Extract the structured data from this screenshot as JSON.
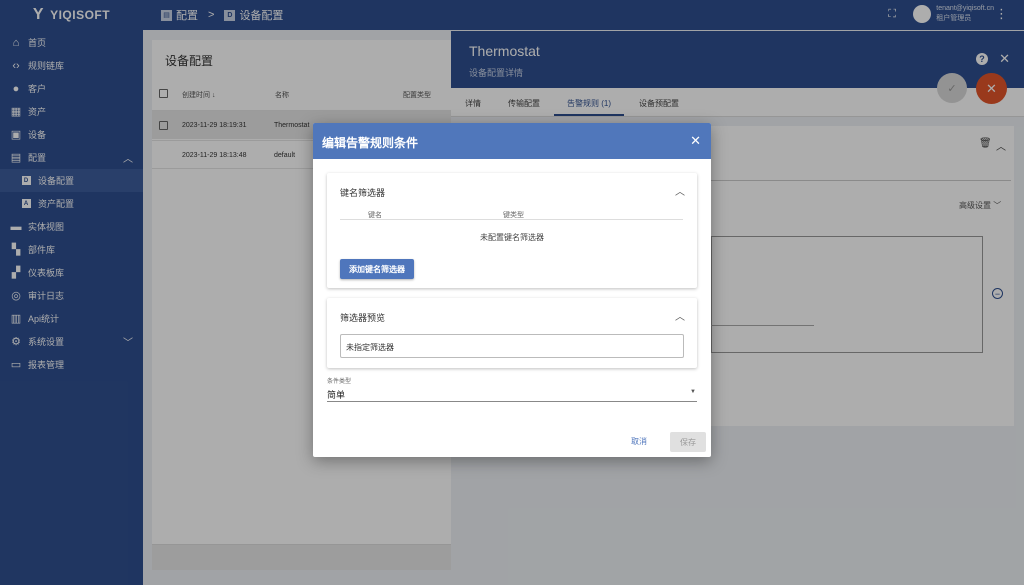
{
  "brand": {
    "name": "YIQISOFT"
  },
  "sidebar": {
    "items": [
      {
        "label": "首页",
        "icon": "home-icon"
      },
      {
        "label": "规则链库",
        "icon": "code-icon"
      },
      {
        "label": "客户",
        "icon": "people-icon"
      },
      {
        "label": "资产",
        "icon": "building-icon"
      },
      {
        "label": "设备",
        "icon": "devices-icon"
      },
      {
        "label": "配置",
        "icon": "settings-box-icon"
      },
      {
        "label": "设备配置",
        "icon": "device-profile-icon"
      },
      {
        "label": "资产配置",
        "icon": "asset-profile-icon"
      },
      {
        "label": "实体视图",
        "icon": "view-icon"
      },
      {
        "label": "部件库",
        "icon": "widgets-icon"
      },
      {
        "label": "仪表板库",
        "icon": "dashboard-icon"
      },
      {
        "label": "审计日志",
        "icon": "track-icon"
      },
      {
        "label": "Api统计",
        "icon": "chart-icon"
      },
      {
        "label": "系统设置",
        "icon": "gear-icon"
      },
      {
        "label": "报表管理",
        "icon": "report-icon"
      }
    ]
  },
  "topbar": {
    "crumb_parent": "配置",
    "crumb_sep": ">",
    "crumb_current": "设备配置",
    "user_email": "tenant@yiqisoft.cn",
    "user_role": "租户管理员"
  },
  "list": {
    "title": "设备配置",
    "columns": [
      "创建时间",
      "名称",
      "配置类型"
    ],
    "rows": [
      {
        "created": "2023-11-29 18:19:31",
        "name": "Thermostat"
      },
      {
        "created": "2023-11-29 18:13:48",
        "name": "default"
      }
    ]
  },
  "panel": {
    "title": "Thermostat",
    "subtitle": "设备配置详情",
    "tabs": [
      "详情",
      "传输配置",
      "告警规则 (1)",
      "设备预配置"
    ],
    "advanced": "高级设置"
  },
  "dialog": {
    "title": "编辑告警规则条件",
    "key_filters": {
      "title": "键名筛选器",
      "col_key": "键名",
      "col_type": "键类型",
      "empty": "未配置键名筛选器",
      "add_button": "添加键名筛选器"
    },
    "preview": {
      "title": "筛选器预览",
      "value": "未指定筛选器"
    },
    "condition_type": {
      "label": "条件类型",
      "value": "简单"
    },
    "cancel": "取消",
    "save": "保存"
  },
  "colors": {
    "primary": "#2f4f8f",
    "dialog_header": "#5077bb",
    "accent": "#e2552a"
  }
}
